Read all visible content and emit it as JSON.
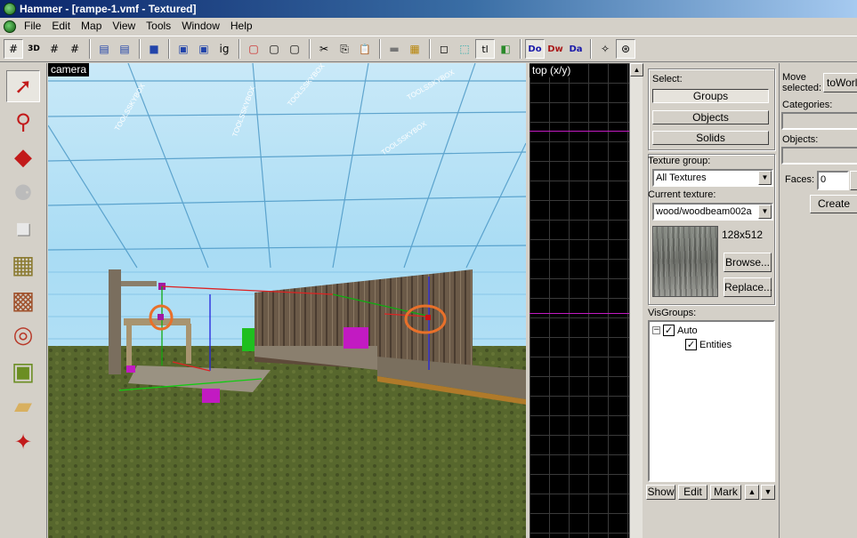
{
  "window": {
    "title": "Hammer - [rampe-1.vmf - Textured]"
  },
  "menu": {
    "items": [
      "File",
      "Edit",
      "Map",
      "View",
      "Tools",
      "Window",
      "Help"
    ]
  },
  "toolbar": {
    "glyphs": [
      "#",
      "3D",
      "#",
      "#",
      "▤",
      "▤",
      "■",
      "▣",
      "▣",
      "ig",
      "▢",
      "▢",
      "▢",
      "✂",
      "⎘",
      "📋",
      "▬",
      "▦",
      "◻",
      "⬚",
      "tl",
      "◧",
      "Do",
      "Dw",
      "Da",
      "✧",
      "⊛"
    ]
  },
  "tools": [
    {
      "name": "selection-tool",
      "glyph": "➚"
    },
    {
      "name": "magnify-tool",
      "glyph": "⚲"
    },
    {
      "name": "camera-tool",
      "glyph": "◆"
    },
    {
      "name": "entity-tool",
      "glyph": "⚈"
    },
    {
      "name": "block-tool",
      "glyph": "■"
    },
    {
      "name": "texture-application-tool",
      "glyph": "▦"
    },
    {
      "name": "apply-texture-tool",
      "glyph": "▩"
    },
    {
      "name": "decal-tool",
      "glyph": "◎"
    },
    {
      "name": "overlay-tool",
      "glyph": "▣"
    },
    {
      "name": "clipping-tool",
      "glyph": "▰"
    },
    {
      "name": "vertex-tool",
      "glyph": "✦"
    }
  ],
  "camera_view": {
    "label": "camera",
    "sky_texts": [
      "TOOLSSKYBOX",
      "TOOLSSKYBOX",
      "TOOLSSKYBOX",
      "TOOLSSKYBOX",
      "TOOLSSKYBOX"
    ]
  },
  "top_view": {
    "label": "top (x/y)"
  },
  "select_panel": {
    "label": "Select:",
    "groups": "Groups",
    "objects": "Objects",
    "solids": "Solids"
  },
  "texture_panel": {
    "group_label": "Texture group:",
    "group_value": "All Textures",
    "current_label": "Current texture:",
    "current_value": "wood/woodbeam002a",
    "size": "128x512",
    "browse": "Browse...",
    "replace": "Replace..."
  },
  "visgroups": {
    "label": "VisGroups:",
    "items": [
      {
        "label": "Auto",
        "expander": "−",
        "checked": "✓"
      },
      {
        "label": "Entities",
        "checked": "✓"
      }
    ],
    "show": "Show",
    "edit": "Edit",
    "mark": "Mark",
    "up": "▲",
    "down": "▼"
  },
  "move_panel": {
    "label": "Move selected:",
    "to_world": "toWorld",
    "categories": "Categories:",
    "objects": "Objects:",
    "faces": "Faces:",
    "faces_value": "0",
    "create_prefab": "Create Prefab"
  },
  "colors": {
    "title_start": "#0a246a",
    "title_end": "#a6caf0",
    "face": "#d4d0c8",
    "sky": "#a9dcf4",
    "grid_line": "#3a3a3a",
    "highlight": "#e8702a"
  }
}
